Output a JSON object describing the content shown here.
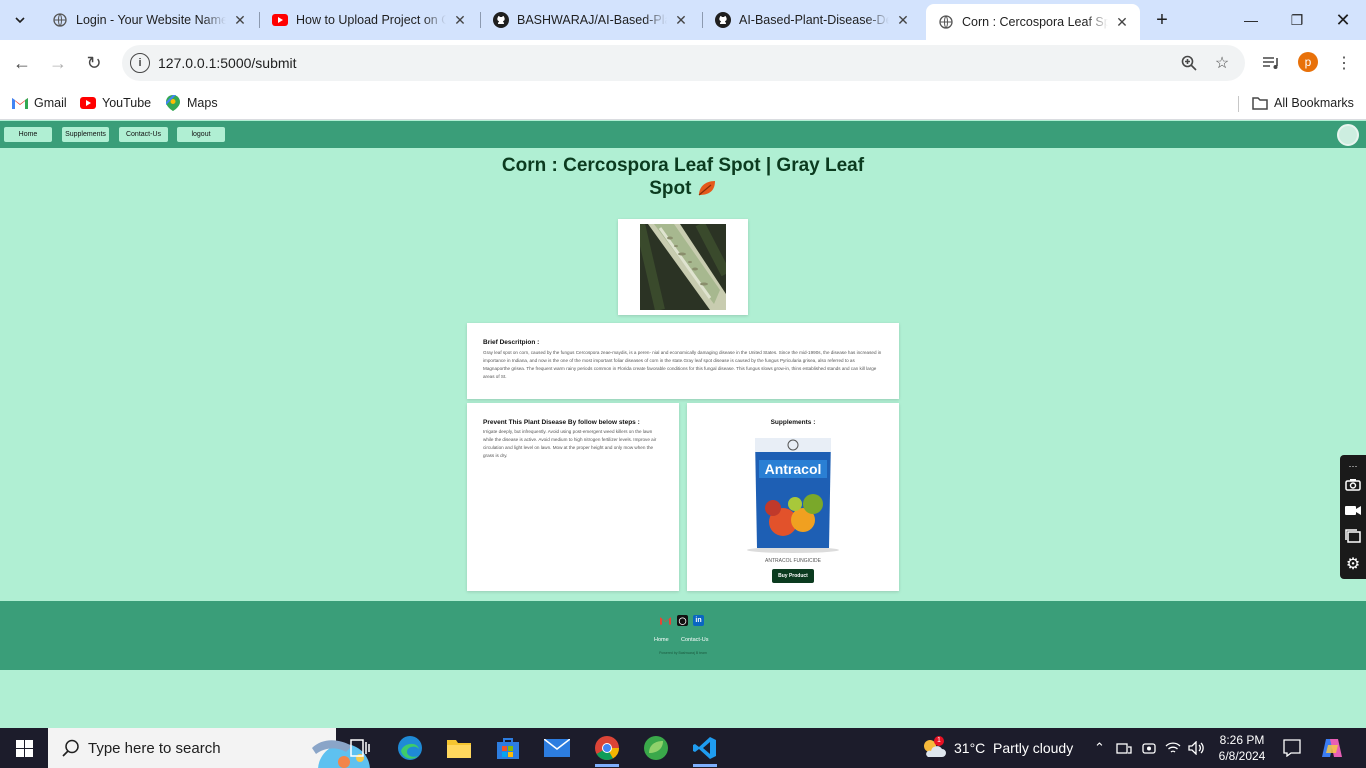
{
  "browser": {
    "tabs": [
      {
        "title": "Login - Your Website Name",
        "favicon": "globe-icon"
      },
      {
        "title": "How to Upload Project on GitHub",
        "favicon": "youtube-icon"
      },
      {
        "title": "BASHWARAJ/AI-Based-Plant-Disease",
        "favicon": "github-icon"
      },
      {
        "title": "AI-Based-Plant-Disease-Detection",
        "favicon": "github-icon"
      },
      {
        "title": "Corn : Cercospora Leaf Spot | Gray Leaf Spot",
        "favicon": "globe-icon",
        "active": true
      }
    ],
    "url": "127.0.0.1:5000/submit",
    "profile_initial": "p",
    "bookmarks": [
      {
        "label": "Gmail",
        "icon": "gmail-icon"
      },
      {
        "label": "YouTube",
        "icon": "youtube-icon"
      },
      {
        "label": "Maps",
        "icon": "maps-icon"
      }
    ],
    "all_bookmarks_label": "All Bookmarks"
  },
  "site": {
    "nav": [
      "Home",
      "Supplements",
      "Contact-Us",
      "logout"
    ],
    "title": "Corn : Cercospora Leaf Spot | Gray Leaf Spot",
    "description_heading": "Brief Descritpion :",
    "description_text": "Gray leaf spot on corn, caused by the fungus Cercospora zeae-maydis, is a peren- nial and economically damaging disease in the United States. Since the mid-1990s, the disease has increased in importance in Indiana, and now is the one of the most important foliar diseases of corn in the state.Gray leaf spot disease is caused by the fungus Pyricularia grisea, also referred to as Magnaporthe grisea. The frequent warm rainy periods common in Florida create favorable conditions for this fungal disease. This fungus slows grow-in, thins established stands and can kill large areas of St.",
    "prevent_heading": "Prevent This Plant Disease By follow below steps :",
    "prevent_text": "Irrigate deeply, but infrequently. Avoid using post-emergent weed killers on the lawn while the disease is active. Avoid medium to high nitrogen fertilizer levels. Improve air circulation and light level on lawn. Mow at the proper height and only mow when the grass is dry.",
    "supplements_heading": "Supplements :",
    "product_name": "ANTRACOL FUNGICIDE",
    "product_brand": "Antracol",
    "buy_label": "Buy Product",
    "footer_links": [
      "Home",
      "Contact-Us"
    ],
    "footer_copy": "Powered by Bashwaraj B team"
  },
  "taskbar": {
    "search_placeholder": "Type here to search",
    "weather": "31°C  Partly cloudy",
    "weather_badge": "1",
    "time": "8:26 PM",
    "date": "6/8/2024"
  },
  "colors": {
    "page_bg": "#b0efd3",
    "nav_bg": "#3a9e79",
    "title": "#0b3b1f",
    "buy_button": "#0b3b1f"
  }
}
